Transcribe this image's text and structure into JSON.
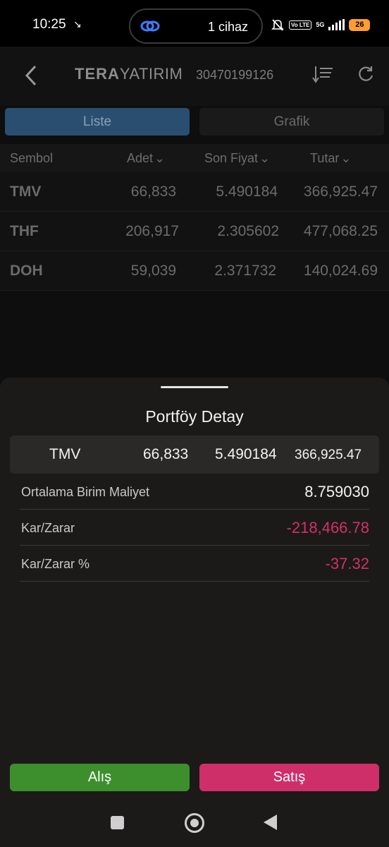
{
  "status_bar": {
    "time": "10:25",
    "connected_devices": "1 cihaz",
    "network": "5G",
    "volte": "Vo LTE",
    "battery": "26"
  },
  "header": {
    "brand_bold": "TERA",
    "brand_light": "YATIRIM",
    "account_number": "30470199126"
  },
  "tabs": [
    {
      "label": "Liste",
      "active": true
    },
    {
      "label": "Grafik",
      "active": false
    }
  ],
  "table": {
    "columns": [
      "Sembol",
      "Adet",
      "Son Fiyat",
      "Tutar"
    ],
    "sortable_indicator": "⌄",
    "rows": [
      {
        "symbol": "TMV",
        "quantity": "66,833",
        "last_price": "5.490184",
        "amount": "366,925.47"
      },
      {
        "symbol": "THF",
        "quantity": "206,917",
        "last_price": "2.305602",
        "amount": "477,068.25"
      },
      {
        "symbol": "DOH",
        "quantity": "59,039",
        "last_price": "2.371732",
        "amount": "140,024.69"
      }
    ]
  },
  "sheet": {
    "title": "Portföy Detay",
    "selected": {
      "symbol": "TMV",
      "quantity": "66,833",
      "last_price": "5.490184",
      "amount": "366,925.47"
    },
    "details": [
      {
        "label": "Ortalama Birim Maliyet",
        "value": "8.759030",
        "negative": false
      },
      {
        "label": "Kar/Zarar",
        "value": "-218,466.78",
        "negative": true
      },
      {
        "label": "Kar/Zarar %",
        "value": "-37.32",
        "negative": true
      }
    ]
  },
  "actions": {
    "buy_label": "Alış",
    "sell_label": "Satış"
  },
  "colors": {
    "buy": "#3d8f2e",
    "sell": "#cf2f69",
    "negative": "#d1306a",
    "active_tab": "#2a4e70"
  }
}
